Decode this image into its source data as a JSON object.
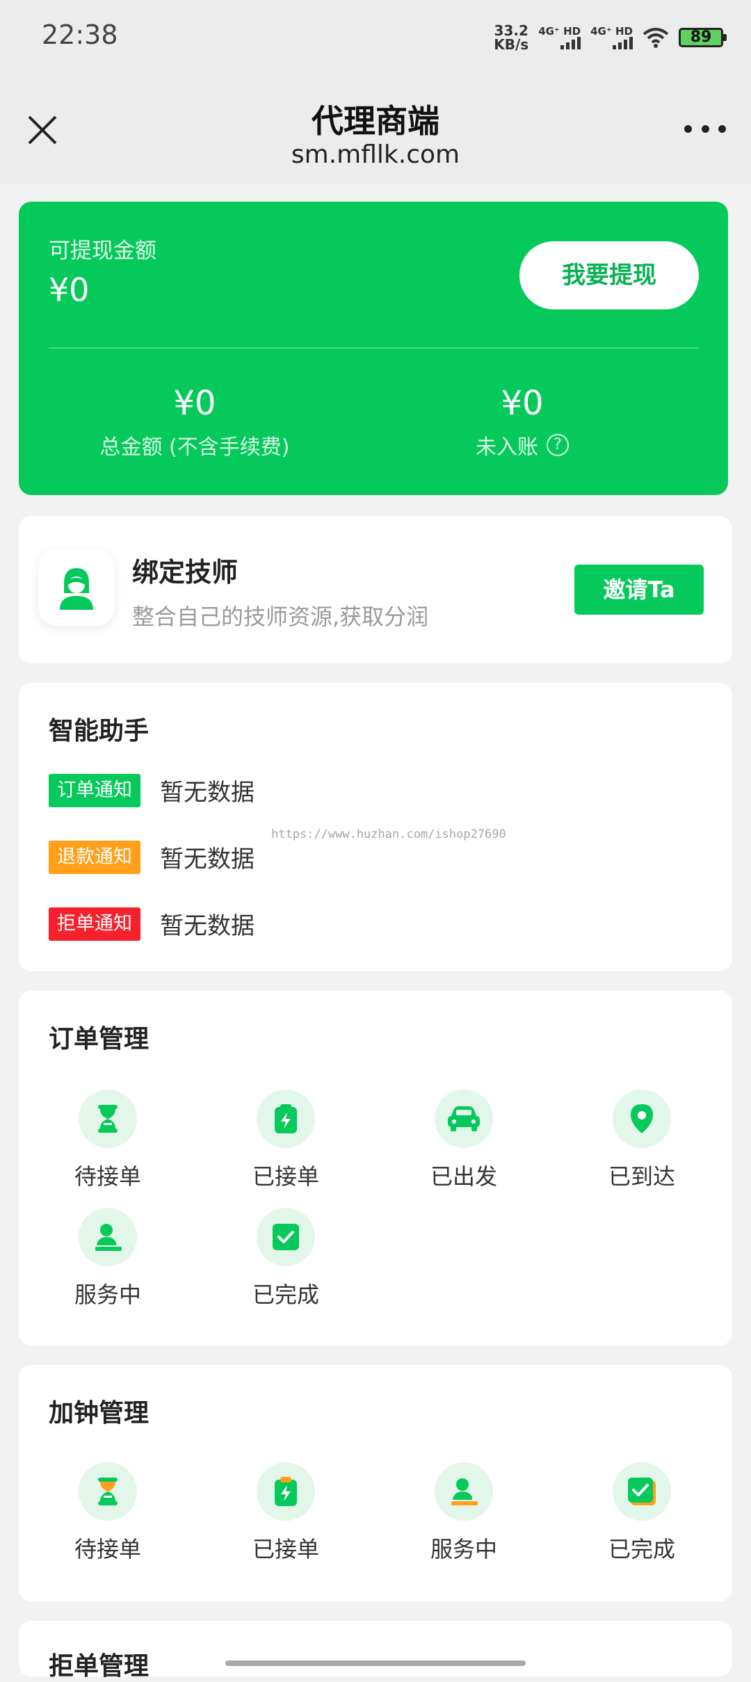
{
  "status_bar": {
    "time": "22:38",
    "net_speed_value": "33.2",
    "net_speed_unit": "KB/s",
    "sim1": "4G⁺ HD",
    "sim2": "4G⁺ HD",
    "battery": "89",
    "wifi_icon": "wifi-icon"
  },
  "nav": {
    "title": "代理商端",
    "subtitle": "sm.mfllk.com",
    "close_icon": "close-icon",
    "more_icon": "more-icon"
  },
  "balance": {
    "label": "可提现金额",
    "amount": "¥0",
    "withdraw_label": "我要提现",
    "total_value": "¥0",
    "total_label": "总金额 (不含手续费)",
    "pending_value": "¥0",
    "pending_label": "未入账",
    "help_icon": "?"
  },
  "bind": {
    "title": "绑定技师",
    "subtitle": "整合自己的技师资源,获取分润",
    "invite_label": "邀请Ta"
  },
  "assistant": {
    "title": "智能助手",
    "notices": [
      {
        "tag": "订单通知",
        "text": "暂无数据",
        "color": "#06c95b"
      },
      {
        "tag": "退款通知",
        "text": "暂无数据",
        "color": "#ff9f1a"
      },
      {
        "tag": "拒单通知",
        "text": "暂无数据",
        "color": "#f5222d"
      }
    ],
    "watermark": "https://www.huzhan.com/ishop27690"
  },
  "orders": {
    "title": "订单管理",
    "items": [
      {
        "label": "待接单",
        "icon": "hourglass-icon"
      },
      {
        "label": "已接单",
        "icon": "clipboard-bolt-icon"
      },
      {
        "label": "已出发",
        "icon": "car-icon"
      },
      {
        "label": "已到达",
        "icon": "location-pin-icon"
      },
      {
        "label": "服务中",
        "icon": "person-service-icon"
      },
      {
        "label": "已完成",
        "icon": "check-square-icon"
      }
    ]
  },
  "extend": {
    "title": "加钟管理",
    "items": [
      {
        "label": "待接单",
        "icon": "hourglass-icon"
      },
      {
        "label": "已接单",
        "icon": "clipboard-bolt-icon"
      },
      {
        "label": "服务中",
        "icon": "person-service-icon"
      },
      {
        "label": "已完成",
        "icon": "check-square-icon"
      }
    ]
  },
  "reject": {
    "title": "拒单管理"
  },
  "colors": {
    "brand_green": "#06c95b",
    "accent_orange": "#ff9f1a",
    "alert_red": "#f5222d"
  }
}
